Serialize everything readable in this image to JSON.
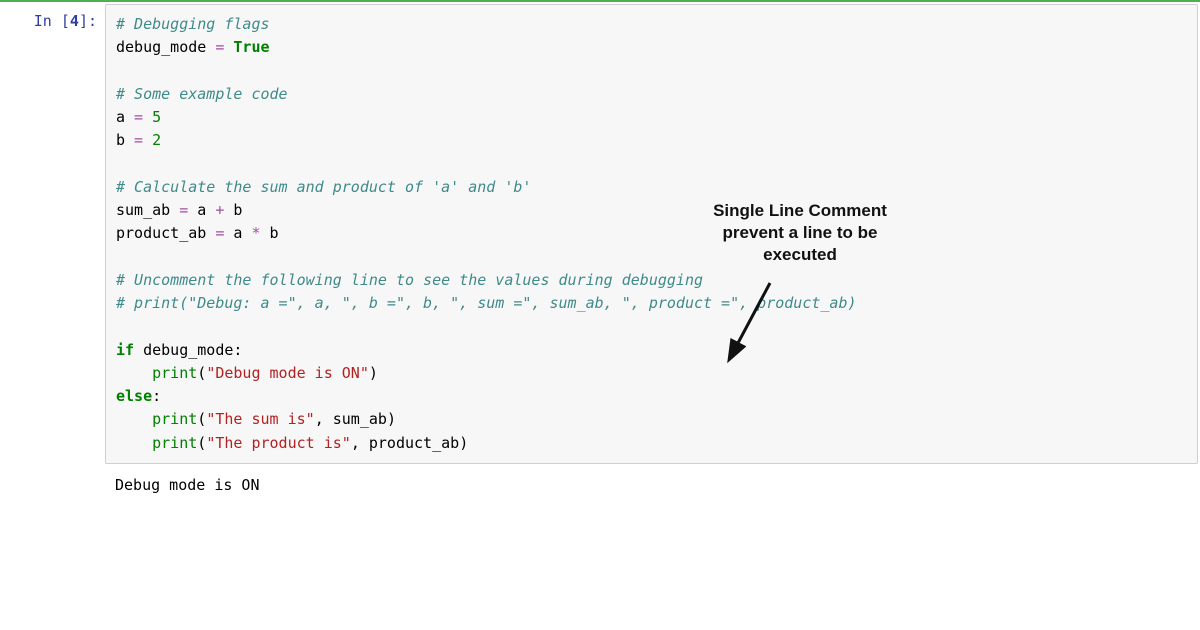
{
  "prompt": {
    "label": "In [",
    "num": "4",
    "close": "]:"
  },
  "code": {
    "l1": "# Debugging flags",
    "l2a": "debug_mode",
    "l2b": " = ",
    "l2c": "True",
    "l3": "",
    "l4": "# Some example code",
    "l5a": "a",
    "l5b": " = ",
    "l5c": "5",
    "l6a": "b",
    "l6b": " = ",
    "l6c": "2",
    "l7": "",
    "l8": "# Calculate the sum and product of 'a' and 'b'",
    "l9a": "sum_ab",
    "l9b": " = ",
    "l9c": "a",
    "l9d": " + ",
    "l9e": "b",
    "l10a": "product_ab",
    "l10b": " = ",
    "l10c": "a",
    "l10d": " * ",
    "l10e": "b",
    "l11": "",
    "l12": "# Uncomment the following line to see the values during debugging",
    "l13": "# print(\"Debug: a =\", a, \", b =\", b, \", sum =\", sum_ab, \", product =\", product_ab)",
    "l14": "",
    "l15a": "if",
    "l15b": " debug_mode",
    "l15c": ":",
    "l16pad": "    ",
    "l16a": "print",
    "l16b": "(",
    "l16c": "\"Debug mode is ON\"",
    "l16d": ")",
    "l17a": "else",
    "l17b": ":",
    "l18pad": "    ",
    "l18a": "print",
    "l18b": "(",
    "l18c": "\"The sum is\"",
    "l18d": ", sum_ab",
    "l18e": ")",
    "l19pad": "    ",
    "l19a": "print",
    "l19b": "(",
    "l19c": "\"The product is\"",
    "l19d": ", product_ab",
    "l19e": ")"
  },
  "output": "Debug mode is ON",
  "annotation": {
    "line1": "Single Line Comment",
    "line2": "prevent a line to be",
    "line3": "executed"
  }
}
